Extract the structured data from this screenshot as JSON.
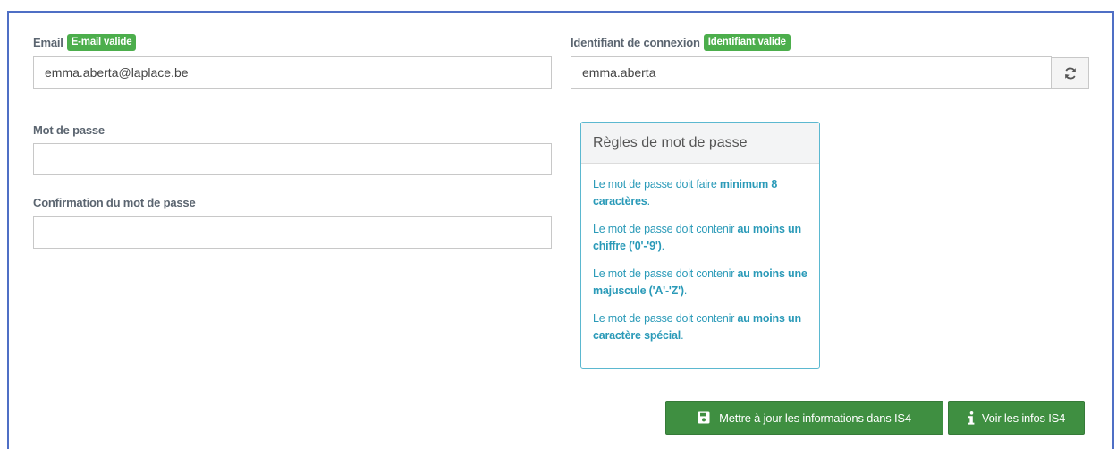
{
  "email": {
    "label": "Email",
    "badge": "E-mail valide",
    "value": "emma.aberta@laplace.be"
  },
  "login": {
    "label": "Identifiant de connexion",
    "badge": "Identifiant valide",
    "value": "emma.aberta",
    "refresh_icon": "refresh-icon"
  },
  "password": {
    "label": "Mot de passe",
    "value": ""
  },
  "password_confirm": {
    "label": "Confirmation du mot de passe",
    "value": ""
  },
  "rules": {
    "title": "Règles de mot de passe",
    "items": [
      {
        "pre": "Le mot de passe doit faire ",
        "bold": "minimum 8 caractères",
        "post": "."
      },
      {
        "pre": "Le mot de passe doit contenir ",
        "bold": "au moins un chiffre ('0'-'9')",
        "post": "."
      },
      {
        "pre": "Le mot de passe doit contenir ",
        "bold": "au moins une majuscule ('A'-'Z')",
        "post": "."
      },
      {
        "pre": "Le mot de passe doit contenir ",
        "bold": "au moins un caractère spécial",
        "post": "."
      }
    ]
  },
  "actions": {
    "update_label": "Mettre à jour les informations dans IS4",
    "update_icon": "floppy-disk-icon",
    "info_label": "Voir les infos IS4",
    "info_icon": "info-icon"
  },
  "colors": {
    "badge_green": "#4cae4c",
    "button_green": "#3f8f41",
    "rules_text": "#2a9ab8",
    "rules_border": "#5bb8d0",
    "frame_border": "#4f6fc5"
  }
}
